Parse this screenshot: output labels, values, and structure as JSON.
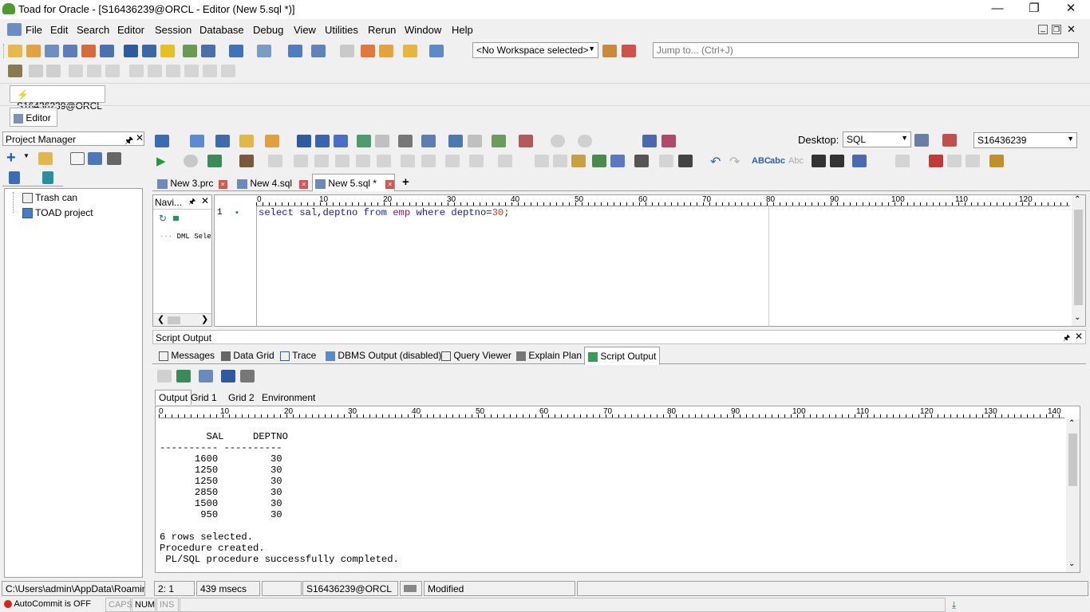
{
  "window": {
    "title": "Toad for Oracle - [S16436239@ORCL - Editor (New 5.sql *)]"
  },
  "menu": [
    "File",
    "Edit",
    "Search",
    "Editor",
    "Session",
    "Database",
    "Debug",
    "View",
    "Utilities",
    "Rerun",
    "Window",
    "Help"
  ],
  "workspace": {
    "selected": "<No Workspace selected>"
  },
  "jump": {
    "placeholder": "Jump to... (Ctrl+J)"
  },
  "connection_tab": "S16436239@ORCL",
  "editor_window_tab": "Editor",
  "project_manager": {
    "title": "Project Manager",
    "items": [
      "Trash can",
      "TOAD project"
    ]
  },
  "desktop": {
    "label": "Desktop:",
    "value": "SQL"
  },
  "schema_select": "S16436239",
  "editor_tabs": [
    "New 3.prc",
    "New 4.sql",
    "New 5.sql *"
  ],
  "navigator": {
    "title": "Navi...",
    "node": "DML Selec"
  },
  "editor": {
    "line_number": "1",
    "sql": {
      "kw1": "select",
      "cols": " sal,deptno ",
      "kw2": "from",
      "tbl": " emp ",
      "kw3": "where",
      "cond": " deptno=",
      "num": "30",
      "end": ";"
    }
  },
  "ruler_top": [
    "0",
    "10",
    "20",
    "30",
    "40",
    "50",
    "60",
    "70",
    "80",
    "90",
    "100",
    "110",
    "120"
  ],
  "script_output": {
    "title": "Script Output",
    "tabs": [
      "Messages",
      "Data Grid",
      "Trace",
      "DBMS Output (disabled)",
      "Query Viewer",
      "Explain Plan",
      "Script Output"
    ],
    "subtabs": [
      "Output",
      "Grid 1",
      "Grid 2",
      "Environment"
    ],
    "ruler": [
      "0",
      "10",
      "20",
      "30",
      "40",
      "50",
      "60",
      "70",
      "80",
      "90",
      "100",
      "110",
      "120",
      "130",
      "140"
    ],
    "text": "        SAL     DEPTNO\n---------- ----------\n      1600         30\n      1250         30\n      1250         30\n      2850         30\n      1500         30\n       950         30\n\n6 rows selected.\nProcedure created.\n PL/SQL procedure successfully completed."
  },
  "status": {
    "path": "C:\\Users\\admin\\AppData\\Roaming\\Q",
    "position": "2:  1",
    "elapsed": "439 msecs",
    "connection": "S16436239@ORCL",
    "state": "Modified",
    "autocommit": "AutoCommit is OFF",
    "caps": "CAPS",
    "num": "NUM",
    "ins": "INS"
  }
}
